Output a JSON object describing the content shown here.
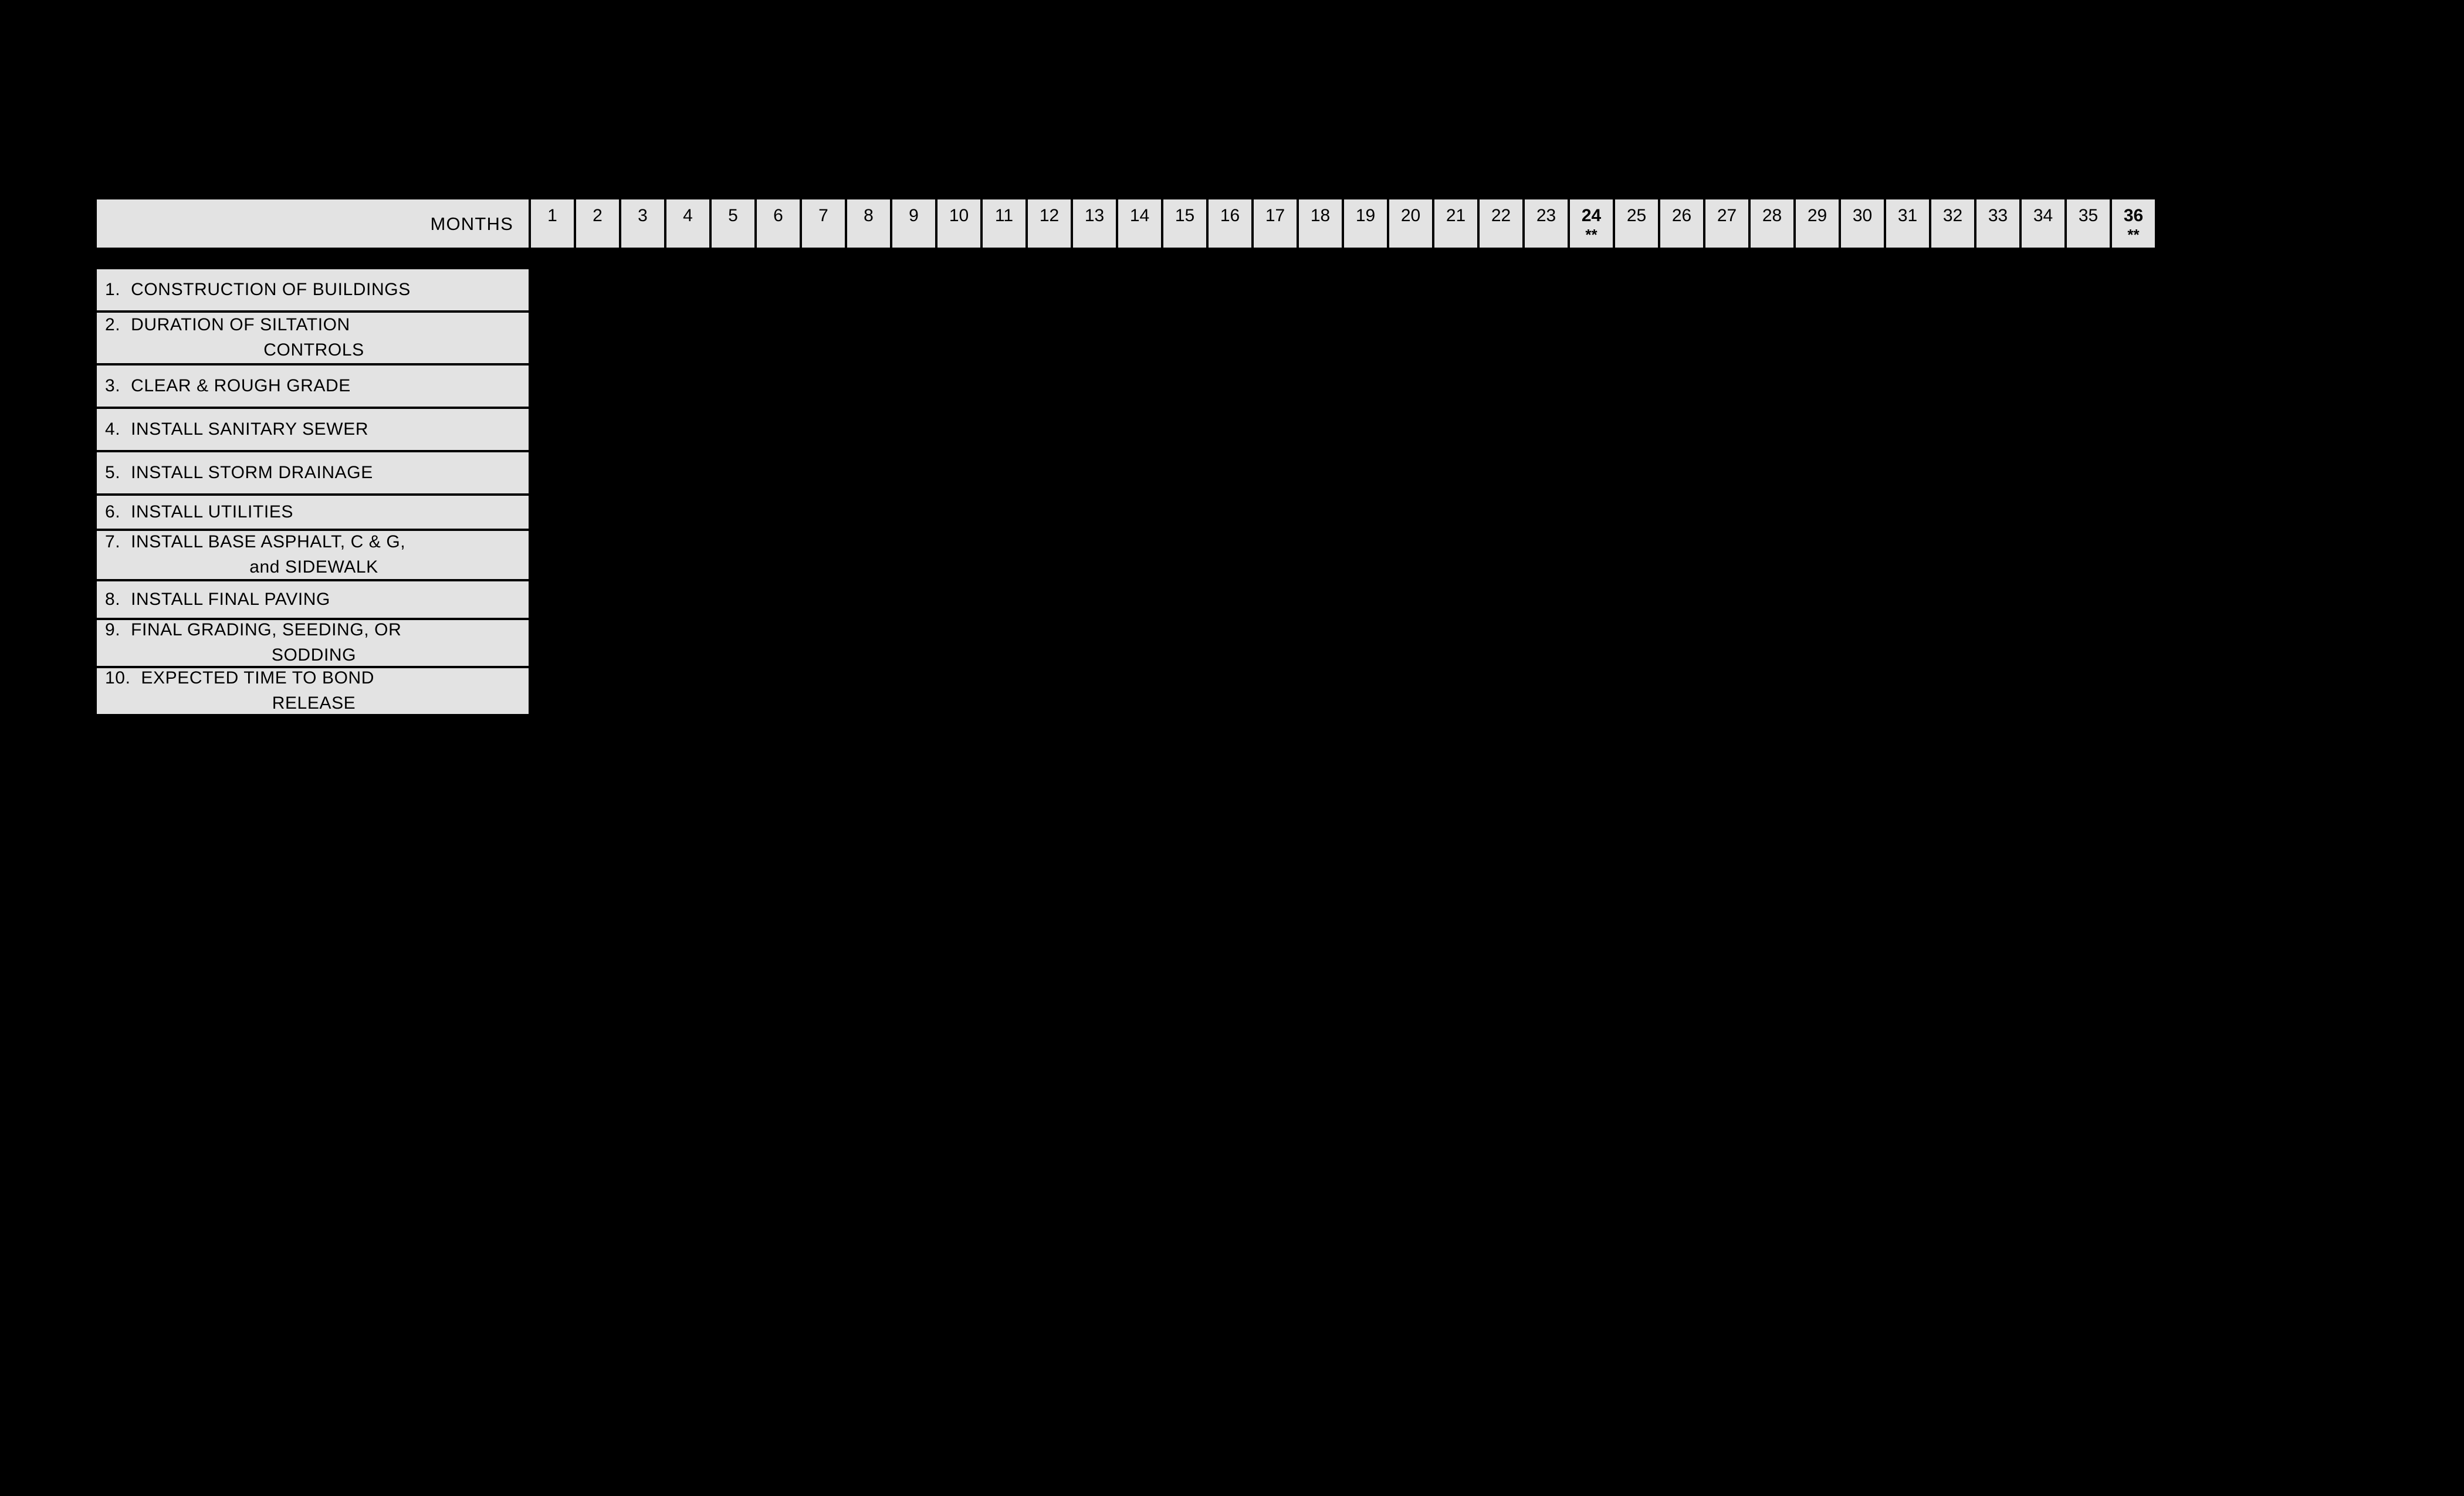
{
  "header": {
    "row_label": "MONTHS",
    "months": [
      {
        "num": "1",
        "mark": ""
      },
      {
        "num": "2",
        "mark": ""
      },
      {
        "num": "3",
        "mark": ""
      },
      {
        "num": "4",
        "mark": ""
      },
      {
        "num": "5",
        "mark": ""
      },
      {
        "num": "6",
        "mark": ""
      },
      {
        "num": "7",
        "mark": ""
      },
      {
        "num": "8",
        "mark": ""
      },
      {
        "num": "9",
        "mark": ""
      },
      {
        "num": "10",
        "mark": ""
      },
      {
        "num": "11",
        "mark": ""
      },
      {
        "num": "12",
        "mark": ""
      },
      {
        "num": "13",
        "mark": ""
      },
      {
        "num": "14",
        "mark": ""
      },
      {
        "num": "15",
        "mark": ""
      },
      {
        "num": "16",
        "mark": ""
      },
      {
        "num": "17",
        "mark": ""
      },
      {
        "num": "18",
        "mark": ""
      },
      {
        "num": "19",
        "mark": ""
      },
      {
        "num": "20",
        "mark": ""
      },
      {
        "num": "21",
        "mark": ""
      },
      {
        "num": "22",
        "mark": ""
      },
      {
        "num": "23",
        "mark": ""
      },
      {
        "num": "24",
        "mark": "**"
      },
      {
        "num": "25",
        "mark": ""
      },
      {
        "num": "26",
        "mark": ""
      },
      {
        "num": "27",
        "mark": ""
      },
      {
        "num": "28",
        "mark": ""
      },
      {
        "num": "29",
        "mark": ""
      },
      {
        "num": "30",
        "mark": ""
      },
      {
        "num": "31",
        "mark": ""
      },
      {
        "num": "32",
        "mark": ""
      },
      {
        "num": "33",
        "mark": ""
      },
      {
        "num": "34",
        "mark": ""
      },
      {
        "num": "35",
        "mark": ""
      },
      {
        "num": "36",
        "mark": "**"
      }
    ]
  },
  "tasks": [
    {
      "number": "1.",
      "line1": "CONSTRUCTION  OF  BUILDINGS",
      "line2": ""
    },
    {
      "number": "2.",
      "line1": "DURATION  OF  SILTATION",
      "line2": "CONTROLS"
    },
    {
      "number": "3.",
      "line1": "CLEAR  &  ROUGH  GRADE",
      "line2": ""
    },
    {
      "number": "4.",
      "line1": "INSTALL  SANITARY  SEWER",
      "line2": ""
    },
    {
      "number": "5.",
      "line1": "INSTALL  STORM  DRAINAGE",
      "line2": ""
    },
    {
      "number": "6.",
      "line1": "INSTALL  UTILITIES",
      "line2": ""
    },
    {
      "number": "7.",
      "line1": "INSTALL BASE  ASPHALT,  C & G,",
      "line2": "and  SIDEWALK"
    },
    {
      "number": "8.",
      "line1": "INSTALL  FINAL  PAVING",
      "line2": ""
    },
    {
      "number": "9.",
      "line1": "FINAL  GRADING,  SEEDING,  OR",
      "line2": "SODDING"
    },
    {
      "number": "10.",
      "line1": "EXPECTED  TIME  TO  BOND",
      "line2": "RELEASE"
    }
  ],
  "colors": {
    "background": "#000000",
    "cell_fill": "#e3e3e3",
    "border": "#000000",
    "text": "#000000"
  }
}
